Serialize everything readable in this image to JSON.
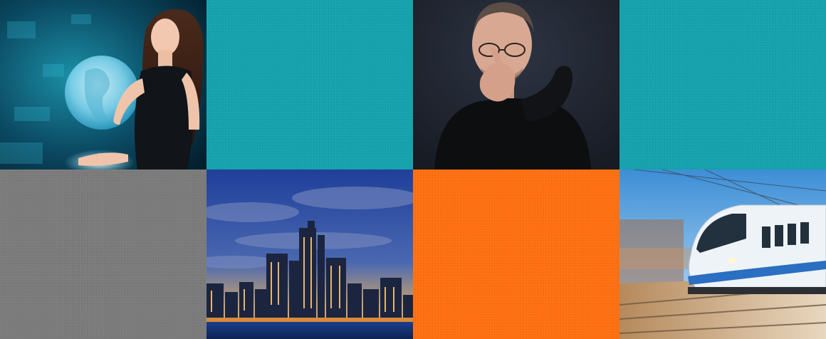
{
  "colors": {
    "teal": "#13a2ad",
    "gray": "#7a7a7a",
    "orange": "#ff6f0f"
  },
  "tiles": [
    {
      "name": "woman-holding-globe",
      "kind": "photo"
    },
    {
      "name": "teal",
      "kind": "solid"
    },
    {
      "name": "man-pointing",
      "kind": "photo"
    },
    {
      "name": "teal",
      "kind": "solid"
    },
    {
      "name": "gray",
      "kind": "solid"
    },
    {
      "name": "city-skyline-at-dusk",
      "kind": "photo"
    },
    {
      "name": "orange",
      "kind": "solid"
    },
    {
      "name": "high-speed-train",
      "kind": "photo"
    }
  ]
}
